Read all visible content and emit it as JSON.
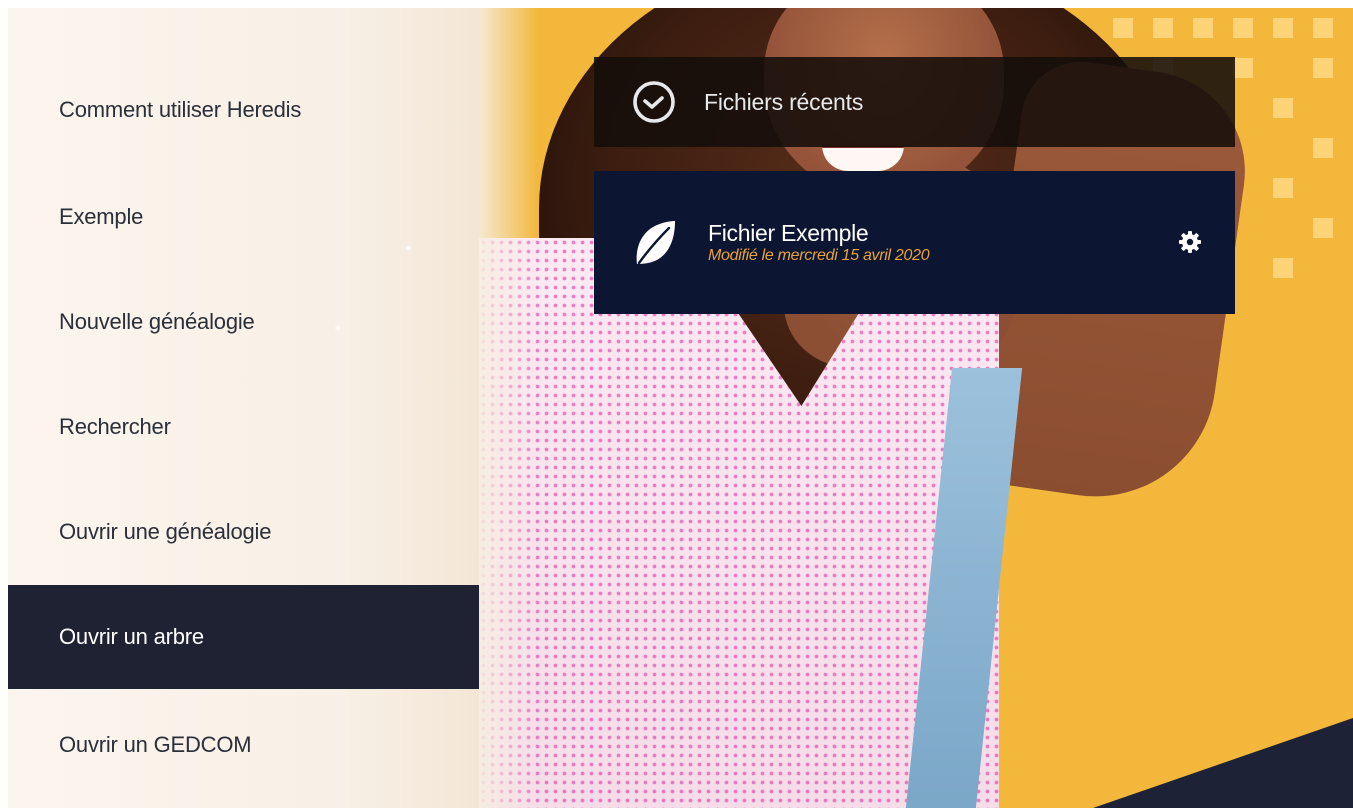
{
  "sidebar": {
    "items": [
      {
        "label": "Comment utiliser Heredis",
        "active": false
      },
      {
        "label": "Exemple",
        "active": false
      },
      {
        "label": "Nouvelle généalogie",
        "active": false
      },
      {
        "label": "Rechercher",
        "active": false
      },
      {
        "label": "Ouvrir une généalogie",
        "active": false
      },
      {
        "label": "Ouvrir un arbre",
        "active": true
      },
      {
        "label": "Ouvrir un GEDCOM",
        "active": false
      }
    ]
  },
  "recent": {
    "title": "Fichiers récents",
    "icon": "clock-icon",
    "files": [
      {
        "name": "Fichier Exemple",
        "modified": "Modifié le mercredi 15 avril 2020",
        "icon": "leaf-icon",
        "action_icon": "gear-icon"
      }
    ]
  },
  "colors": {
    "sidebar_bg": "#fbf3ea",
    "active_item_bg": "#1e2233",
    "hero_bg": "#f2b73b",
    "file_card_bg": "#0c1632",
    "date_accent": "#e8a33a"
  }
}
